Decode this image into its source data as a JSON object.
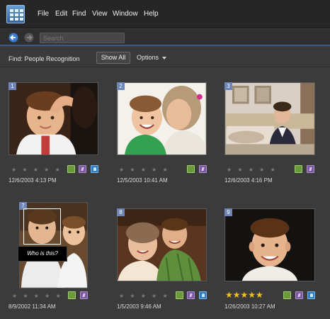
{
  "menubar": {
    "items": [
      "File",
      "Edit",
      "Find",
      "View",
      "Window",
      "Help"
    ]
  },
  "navbar": {
    "search_placeholder": "Search"
  },
  "findbar": {
    "label": "Find: People Recognition",
    "show_all": "Show All",
    "options": "Options"
  },
  "photos": [
    {
      "number": "1",
      "date": "12/6/2003 4:13 PM",
      "rating": 0,
      "tags": [
        "green",
        "purple",
        "blue"
      ]
    },
    {
      "number": "2",
      "date": "12/5/2003 10:41 AM",
      "rating": 0,
      "tags": [
        "green",
        "purple"
      ]
    },
    {
      "number": "3",
      "date": "12/6/2003 4:16 PM",
      "rating": 0,
      "tags": [
        "green",
        "purple"
      ]
    },
    {
      "number": "7",
      "date": "8/9/2002 11:34 AM",
      "rating": 0,
      "tags": [
        "green",
        "purple"
      ]
    },
    {
      "number": "8",
      "date": "1/5/2003 9:46 AM",
      "rating": 0,
      "tags": [
        "green",
        "purple",
        "blue"
      ]
    },
    {
      "number": "9",
      "date": "1/26/2003 10:27 AM",
      "rating": 5,
      "tags": [
        "green",
        "purple",
        "blue"
      ]
    }
  ],
  "face_prompt": "Who is this?",
  "stars": {
    "empty": "★ ★ ★ ★ ★",
    "full": "★★★★★"
  },
  "colors": {
    "accent": "#3d5a85",
    "number_badge": "#6d85b8",
    "star_gold": "#f2c21b"
  }
}
